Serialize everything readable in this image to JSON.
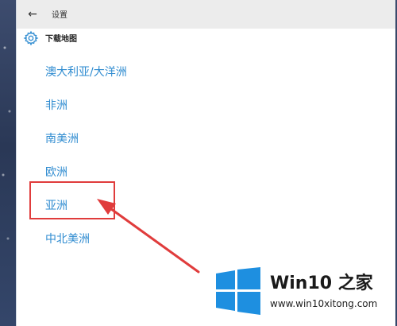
{
  "window": {
    "title": "设置"
  },
  "header": {
    "page_title": "下载地图"
  },
  "continents": [
    {
      "label": "澳大利亚/大洋洲"
    },
    {
      "label": "非洲"
    },
    {
      "label": "南美洲"
    },
    {
      "label": "欧洲"
    },
    {
      "label": "亚洲"
    },
    {
      "label": "中北美洲"
    }
  ],
  "annotation": {
    "highlighted_item": "亚洲",
    "color": "#e03c3c"
  },
  "watermark": {
    "title": "Win10 之家",
    "url": "www.win10xitong.com"
  },
  "colors": {
    "accent": "#2e8bd0",
    "titlebar": "#ececec",
    "highlight": "#e03c3c",
    "logo_blue": "#1e8fe0"
  },
  "icons": {
    "back": "back-arrow-icon",
    "settings": "gear-icon",
    "logo": "windows-logo-icon"
  }
}
